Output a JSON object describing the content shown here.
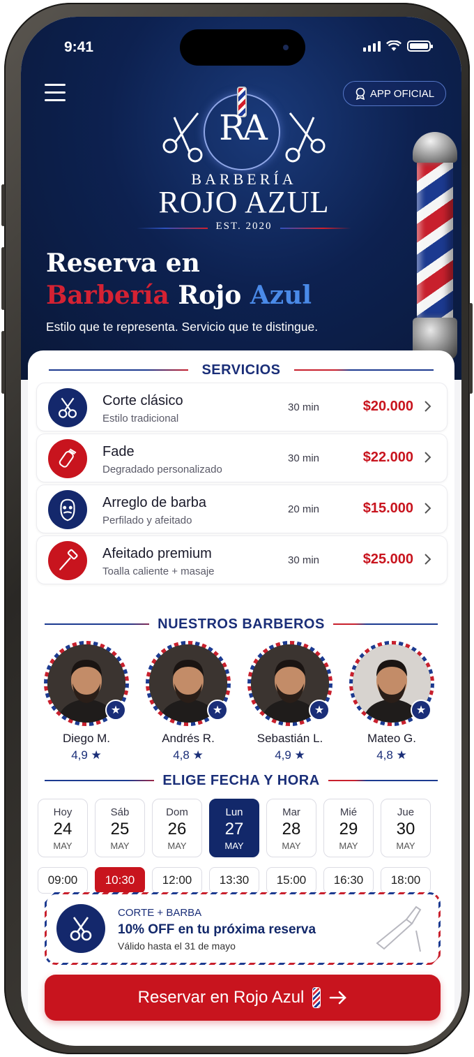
{
  "status_bar": {
    "time": "9:41"
  },
  "header": {
    "menu_icon": "hamburger-menu-icon",
    "badge": {
      "icon": "award-ribbon-icon",
      "label": "APP OFICIAL"
    }
  },
  "logo": {
    "monogram": "RA",
    "line1": "BARBERÍA",
    "line2": "ROJO AZUL",
    "est": "EST. 2020"
  },
  "hero": {
    "title_line1": "Reserva en",
    "title_word_red": "Barbería",
    "title_word_white": "Rojo",
    "title_word_blue": "Azul",
    "subtitle": "Estilo que te representa. Servicio que te distingue."
  },
  "services": {
    "heading": "SERVICIOS",
    "items": [
      {
        "name": "Corte clásico",
        "desc": "Estilo tradicional",
        "duration": "30 min",
        "price": "$20.000",
        "icon": "scissors-icon",
        "icon_bg": "#14286c"
      },
      {
        "name": "Fade",
        "desc": "Degradado personalizado",
        "duration": "30 min",
        "price": "$22.000",
        "icon": "clipper-icon",
        "icon_bg": "#c8141e"
      },
      {
        "name": "Arreglo de barba",
        "desc": "Perfilado y afeitado",
        "duration": "20 min",
        "price": "$15.000",
        "icon": "beard-face-icon",
        "icon_bg": "#14286c"
      },
      {
        "name": "Afeitado premium",
        "desc": "Toalla caliente + masaje",
        "duration": "30 min",
        "price": "$25.000",
        "icon": "razor-icon",
        "icon_bg": "#c8141e"
      }
    ]
  },
  "barbers": {
    "heading": "NUESTROS BARBEROS",
    "items": [
      {
        "name": "Diego M.",
        "rating": "4,9 ★"
      },
      {
        "name": "Andrés R.",
        "rating": "4,8 ★"
      },
      {
        "name": "Sebastián L.",
        "rating": "4,9 ★"
      },
      {
        "name": "Mateo G.",
        "rating": "4,8 ★"
      }
    ]
  },
  "schedule": {
    "heading": "ELIGE FECHA Y HORA",
    "days": [
      {
        "day": "Hoy",
        "date": "24",
        "month": "MAY"
      },
      {
        "day": "Sáb",
        "date": "25",
        "month": "MAY"
      },
      {
        "day": "Dom",
        "date": "26",
        "month": "MAY"
      },
      {
        "day": "Lun",
        "date": "27",
        "month": "MAY"
      },
      {
        "day": "Mar",
        "date": "28",
        "month": "MAY"
      },
      {
        "day": "Mié",
        "date": "29",
        "month": "MAY"
      },
      {
        "day": "Jue",
        "date": "30",
        "month": "MAY"
      }
    ],
    "selected_day": "27",
    "times": [
      "09:00",
      "10:30",
      "12:00",
      "13:30",
      "15:00",
      "16:30",
      "18:00"
    ],
    "selected_time": "10:30"
  },
  "promo": {
    "tag": "CORTE + BARBA",
    "title": "10% OFF en tu próxima reserva",
    "valid": "Válido hasta el 31 de mayo",
    "icon": "scissors-icon",
    "decor_icon": "straight-razor-icon"
  },
  "cta": {
    "label": "Reservar en Rojo Azul",
    "icon": "barber-pole-icon",
    "arrow_icon": "arrow-right-icon"
  },
  "colors": {
    "navy": "#14286c",
    "red": "#c8141e",
    "blue_accent": "#4a8ae8"
  }
}
